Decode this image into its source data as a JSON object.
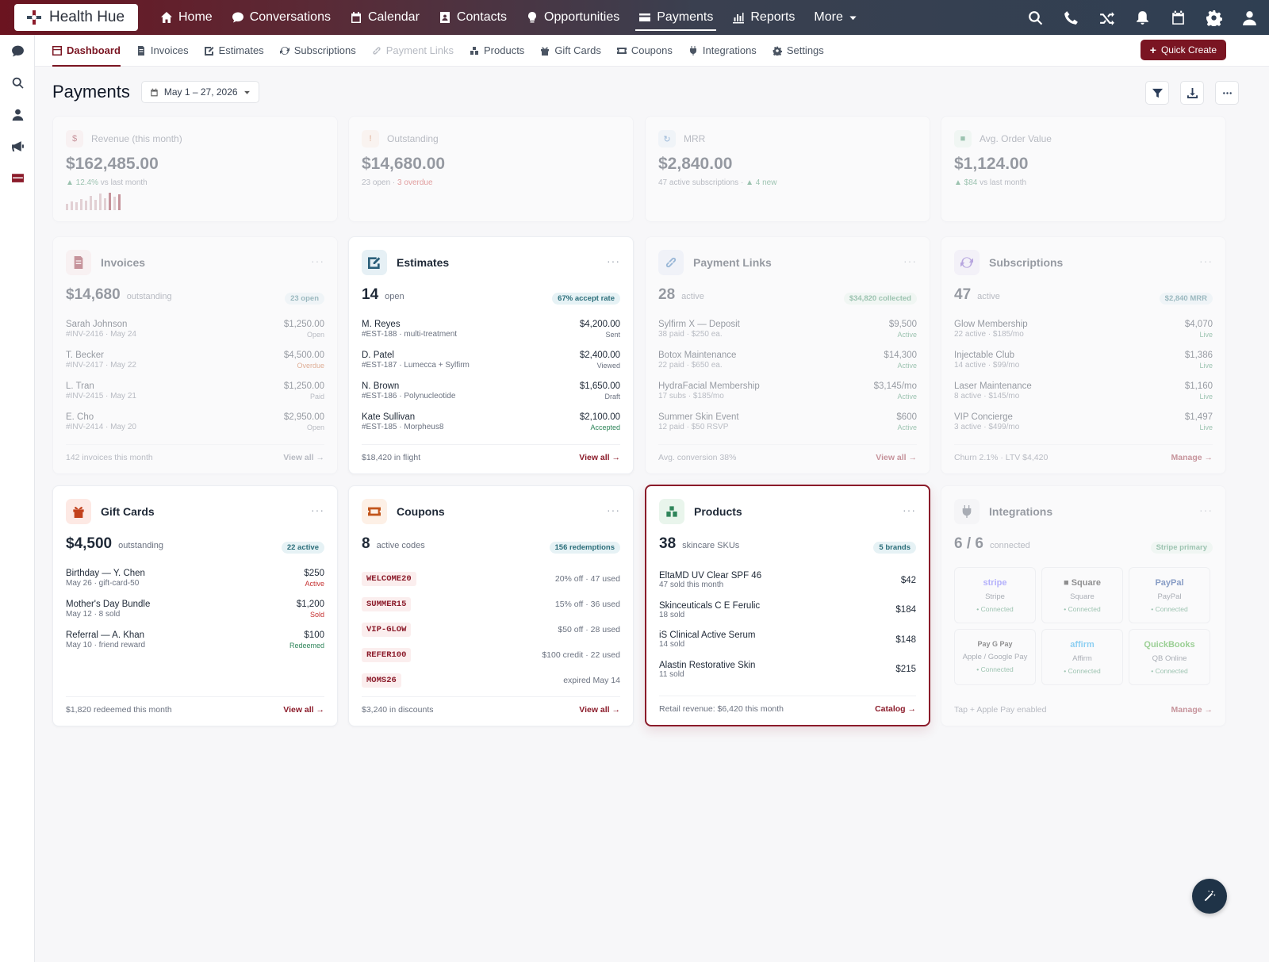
{
  "app": {
    "name": "Health Hue"
  },
  "nav": [
    {
      "label": "Home",
      "icon": "home-icon"
    },
    {
      "label": "Conversations",
      "icon": "chat-icon"
    },
    {
      "label": "Calendar",
      "icon": "calendar-icon"
    },
    {
      "label": "Contacts",
      "icon": "contact-card-icon"
    },
    {
      "label": "Opportunities",
      "icon": "lightbulb-icon"
    },
    {
      "label": "Payments",
      "icon": "credit-card-icon",
      "active": true
    },
    {
      "label": "Reports",
      "icon": "bar-chart-icon"
    },
    {
      "label": "More",
      "icon": "chevron-down-icon"
    }
  ],
  "topbar_icons": [
    "search-icon",
    "phone-icon",
    "shuffle-icon",
    "bell-icon",
    "calendar-icon",
    "gear-icon",
    "user-icon"
  ],
  "sidebar_icons": [
    "chat-icon",
    "search-icon",
    "user-icon",
    "megaphone-icon",
    "credit-card-icon"
  ],
  "subnav": {
    "tabs": [
      {
        "label": "Dashboard",
        "state": "active"
      },
      {
        "label": "Invoices",
        "state": "normal"
      },
      {
        "label": "Estimates",
        "state": "normal"
      },
      {
        "label": "Subscriptions",
        "state": "normal"
      },
      {
        "label": "Payment Links",
        "state": "muted"
      },
      {
        "label": "Products",
        "state": "normal"
      },
      {
        "label": "Gift Cards",
        "state": "normal"
      },
      {
        "label": "Coupons",
        "state": "normal"
      },
      {
        "label": "Integrations",
        "state": "normal"
      },
      {
        "label": "Settings",
        "state": "normal"
      }
    ],
    "quick_create": "Quick Create"
  },
  "page": {
    "title": "Payments",
    "date_range": "May 1 – 27, 2026"
  },
  "kpis": [
    {
      "label": "Revenue (this month)",
      "icon": "$",
      "value": "$162,485.00",
      "sub_a": "▲ 12.4%",
      "sub_b": " vs last month",
      "sparkline": [
        0.35,
        0.5,
        0.45,
        0.65,
        0.55,
        0.8,
        0.6,
        0.95,
        0.7,
        1.0,
        0.75,
        0.9
      ]
    },
    {
      "label": "Outstanding",
      "icon": "!",
      "value": "$14,680.00",
      "sub_a": "23 open · ",
      "sub_b": "3 overdue"
    },
    {
      "label": "MRR",
      "icon": "↻",
      "value": "$2,840.00",
      "sub_a": "47 active subscriptions · ",
      "sub_b": "▲ 4 new"
    },
    {
      "label": "Avg. Order Value",
      "icon": "■",
      "value": "$1,124.00",
      "sub_a": "▲ $84",
      "sub_b": " vs last month"
    }
  ],
  "invoices": {
    "title": "Invoices",
    "value": "$14,680",
    "unit": "outstanding",
    "badge": "23 open",
    "rows": [
      {
        "name": "Sarah Johnson",
        "meta": "#INV-2416 · May 24",
        "amount": "$1,250.00",
        "status": "Open"
      },
      {
        "name": "T. Becker",
        "meta": "#INV-2417 · May 22",
        "amount": "$4,500.00",
        "status": "Overdue"
      },
      {
        "name": "L. Tran",
        "meta": "#INV-2415 · May 21",
        "amount": "$1,250.00",
        "status": "Paid"
      },
      {
        "name": "E. Cho",
        "meta": "#INV-2414 · May 20",
        "amount": "$2,950.00",
        "status": "Open"
      }
    ],
    "footer": "142 invoices this month",
    "link": "View all →"
  },
  "estimates": {
    "title": "Estimates",
    "value": "14",
    "unit": "open",
    "badge": "67% accept rate",
    "rows": [
      {
        "name": "M. Reyes",
        "meta": "#EST-188 · multi-treatment",
        "amount": "$4,200.00",
        "status": "Sent"
      },
      {
        "name": "D. Patel",
        "meta": "#EST-187 · Lumecca + Sylfirm",
        "amount": "$2,400.00",
        "status": "Viewed"
      },
      {
        "name": "N. Brown",
        "meta": "#EST-186 · Polynucleotide",
        "amount": "$1,650.00",
        "status": "Draft"
      },
      {
        "name": "Kate Sullivan",
        "meta": "#EST-185 · Morpheus8",
        "amount": "$2,100.00",
        "status": "Accepted"
      }
    ],
    "footer": "$18,420 in flight",
    "link": "View all →"
  },
  "payment_links": {
    "title": "Payment Links",
    "value": "28",
    "unit": "active",
    "badge": "$34,820 collected",
    "rows": [
      {
        "name": "Sylfirm X — Deposit",
        "meta": "38 paid · $250 ea.",
        "amount": "$9,500",
        "status": "Active"
      },
      {
        "name": "Botox Maintenance",
        "meta": "22 paid · $650 ea.",
        "amount": "$14,300",
        "status": "Active"
      },
      {
        "name": "HydraFacial Membership",
        "meta": "17 subs · $185/mo",
        "amount": "$3,145/mo",
        "status": "Active"
      },
      {
        "name": "Summer Skin Event",
        "meta": "12 paid · $50 RSVP",
        "amount": "$600",
        "status": "Active"
      }
    ],
    "footer": "Avg. conversion 38%",
    "link": "View all →"
  },
  "subscriptions": {
    "title": "Subscriptions",
    "value": "47",
    "unit": "active",
    "badge": "$2,840 MRR",
    "rows": [
      {
        "name": "Glow Membership",
        "meta": "22 active · $185/mo",
        "amount": "$4,070",
        "status": "Live"
      },
      {
        "name": "Injectable Club",
        "meta": "14 active · $99/mo",
        "amount": "$1,386",
        "status": "Live"
      },
      {
        "name": "Laser Maintenance",
        "meta": "8 active · $145/mo",
        "amount": "$1,160",
        "status": "Live"
      },
      {
        "name": "VIP Concierge",
        "meta": "3 active · $499/mo",
        "amount": "$1,497",
        "status": "Live"
      }
    ],
    "footer": "Churn 2.1% · LTV $4,420",
    "link": "Manage →"
  },
  "gift_cards": {
    "title": "Gift Cards",
    "value": "$4,500",
    "unit": "outstanding",
    "badge": "22 active",
    "rows": [
      {
        "name": "Birthday — Y. Chen",
        "meta": "May 26 · gift-card-50",
        "amount": "$250",
        "status": "Active"
      },
      {
        "name": "Mother's Day Bundle",
        "meta": "May 12 · 8 sold",
        "amount": "$1,200",
        "status": "Sold"
      },
      {
        "name": "Referral — A. Khan",
        "meta": "May 10 · friend reward",
        "amount": "$100",
        "status": "Redeemed"
      }
    ],
    "footer": "$1,820 redeemed this month",
    "link": "View all →"
  },
  "coupons": {
    "title": "Coupons",
    "value": "8",
    "unit": "active codes",
    "badge": "156 redemptions",
    "rows": [
      {
        "code": "WELCOME20",
        "desc": "20% off · 47 used"
      },
      {
        "code": "SUMMER15",
        "desc": "15% off · 36 used"
      },
      {
        "code": "VIP-GLOW",
        "desc": "$50 off · 28 used"
      },
      {
        "code": "REFER100",
        "desc": "$100 credit · 22 used"
      },
      {
        "code": "MOMS26",
        "desc": "expired May 14"
      }
    ],
    "footer": "$3,240 in discounts",
    "link": "View all →"
  },
  "products": {
    "title": "Products",
    "value": "38",
    "unit": "skincare SKUs",
    "badge": "5 brands",
    "rows": [
      {
        "name": "EltaMD UV Clear SPF 46",
        "meta": "47 sold this month",
        "price": "$42"
      },
      {
        "name": "Skinceuticals C E Ferulic",
        "meta": "18 sold",
        "price": "$184"
      },
      {
        "name": "iS Clinical Active Serum",
        "meta": "14 sold",
        "price": "$148"
      },
      {
        "name": "Alastin Restorative Skin",
        "meta": "11 sold",
        "price": "$215"
      }
    ],
    "footer": "Retail revenue: $6,420 this month",
    "link": "Catalog →"
  },
  "integrations": {
    "title": "Integrations",
    "value": "6 / 6",
    "unit": "connected",
    "badge": "Stripe primary",
    "tiles": [
      {
        "brand": "stripe",
        "label": "Stripe",
        "status": "• Connected"
      },
      {
        "brand": "■ Square",
        "label": "Square",
        "status": "• Connected"
      },
      {
        "brand": "PayPal",
        "label": "PayPal",
        "status": "• Connected"
      },
      {
        "brand": "Pay  G Pay",
        "label": "Apple / Google Pay",
        "status": "• Connected"
      },
      {
        "brand": "affirm",
        "label": "Affirm",
        "status": "• Connected"
      },
      {
        "brand": "QuickBooks",
        "label": "QB Online",
        "status": "• Connected"
      }
    ],
    "footer": "Tap + Apple Pay enabled",
    "link": "Manage →"
  },
  "colors": {
    "brand": "#7a1522",
    "active_status": "#2f855a",
    "overdue": "#c53030",
    "topbar_start": "#6b1420",
    "topbar_end": "#2f3f52"
  }
}
